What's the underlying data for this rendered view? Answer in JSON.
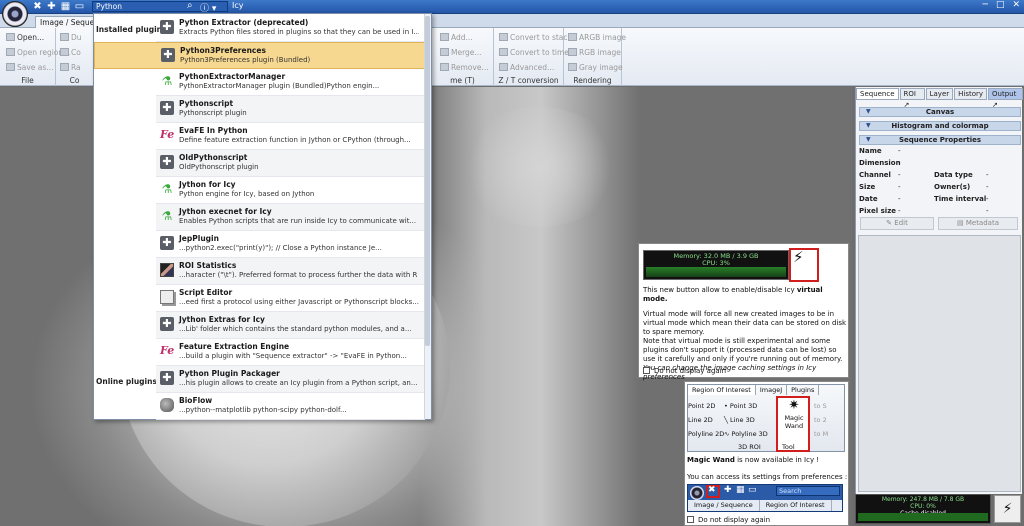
{
  "titlebar": {
    "search_value": "Python",
    "app_title": "Icy",
    "window_buttons": [
      "─",
      "□",
      "✕"
    ]
  },
  "ribbon": {
    "active_tab": "Image / Sequence",
    "file_group": {
      "title": "File",
      "items": [
        "Open...",
        "Open region...",
        "Save as..."
      ]
    },
    "co_group": {
      "title": "Co"
    },
    "middle_items": [
      "Add...",
      "Merge...",
      "Remove..."
    ],
    "middle_title": "me (T)",
    "zt_group": {
      "title": "Z / T conversion",
      "items": [
        "Convert to stack",
        "Convert to time",
        "Advanced..."
      ]
    },
    "render_group": {
      "title": "Rendering",
      "items": [
        "ARGB image",
        "RGB image",
        "Gray image"
      ]
    },
    "partial_left_items": [
      "Du",
      "Co",
      "Ra"
    ]
  },
  "dropdown": {
    "section_installed": "Installed plugins",
    "section_online": "Online plugins",
    "items": [
      {
        "name": "Python Extractor (deprecated)",
        "desc": "Extracts Python files stored in plugins so that they can be used in I...",
        "icon": "puzzle-icon"
      },
      {
        "name": "Python3Preferences",
        "desc": "Python3Preferences plugin (Bundled)",
        "icon": "puzzle-icon"
      },
      {
        "name": "PythonExtractorManager",
        "desc": "PythonExtractorManager plugin (Bundled)Python engin...",
        "icon": "flask-icon"
      },
      {
        "name": "Pythonscript",
        "desc": "Pythonscript plugin",
        "icon": "puzzle-icon"
      },
      {
        "name": "EvaFE In Python",
        "desc": "Define feature extraction function in Jython or CPython (through...",
        "icon": "fe-icon"
      },
      {
        "name": "OldPythonscript",
        "desc": "OldPythonscript plugin",
        "icon": "puzzle-icon"
      },
      {
        "name": "Jython for Icy",
        "desc": "Python engine for Icy, based on Jython",
        "icon": "flask-icon"
      },
      {
        "name": "Jython execnet for Icy",
        "desc": "Enables Python scripts that are run inside Icy to communicate wit...",
        "icon": "flask-icon"
      },
      {
        "name": "JepPlugin",
        "desc": "...python2.exec(\"print(y)\"); // Close a Python instance Je...",
        "icon": "puzzle-icon"
      },
      {
        "name": "ROI Statistics",
        "desc": "...haracter (\"\\t\"). Preferred format to process further the data with R or ...",
        "icon": "roi-icon"
      },
      {
        "name": "Script Editor",
        "desc": "...eed first a protocol using either Javascript or Pythonscript blocks...",
        "icon": "document-icon"
      },
      {
        "name": "Jython Extras for Icy",
        "desc": "...Lib' folder which contains the standard python modules, and a...",
        "icon": "puzzle-icon"
      },
      {
        "name": "Feature Extraction Engine",
        "desc": "...build a plugin with \"Sequence extractor\" -> \"EvaFE in Python...",
        "icon": "fe-icon"
      },
      {
        "name": "Python Plugin Packager",
        "desc": "...his plugin allows to create an Icy plugin from a Python script, an...",
        "icon": "puzzle-icon"
      },
      {
        "name": "BioFlow",
        "desc": "...python--matplotlib python-scipy python-dolf...",
        "icon": "rock-icon"
      }
    ]
  },
  "inspector": {
    "tabs": [
      "Sequence",
      "ROI",
      "Layer",
      "History",
      "Output"
    ],
    "bars": [
      "Canvas",
      "Histogram and colormap",
      "Sequence Properties"
    ],
    "props_left": [
      {
        "label": "Name",
        "value": "-"
      },
      {
        "label": "Dimension",
        "value": "-"
      },
      {
        "label": "Channel",
        "value": "-"
      },
      {
        "label": "Size",
        "value": "-"
      },
      {
        "label": "Date",
        "value": "-"
      },
      {
        "label": "Pixel size",
        "value": "-"
      }
    ],
    "props_right": [
      {
        "label": "Data type",
        "value": "-"
      },
      {
        "label": "Owner(s)",
        "value": "-"
      },
      {
        "label": "Time interval",
        "value": "-"
      },
      {
        "label": "",
        "value": "-"
      }
    ],
    "edit_label": "Edit",
    "metadata_label": "Metadata"
  },
  "popup1": {
    "memory_text": "Memory: 32.0 MB / 3.9 GB",
    "cpu_text": "CPU: 3%",
    "intro_pre": "This new button allow to enable/disable Icy ",
    "intro_bold": "virtual mode.",
    "body_1": "Virtual mode will force all new created images to be in virtual mode which mean their data can be stored on disk to spare memory.",
    "body_2": "Note that virtual mode is still experimental and some plugins don't support it (processed data can be lost) so use it carefully and only if you're running out of memory.",
    "body_3": "You can change the image caching settings in Icy preferences",
    "checkbox_label": "Do not display again"
  },
  "popup2": {
    "tabs": [
      "Region Of Interest",
      "ImageJ",
      "Plugins"
    ],
    "left_items": [
      "Point 2D",
      "Line 2D",
      "Polyline 2D"
    ],
    "mid_items": [
      "Point 3D",
      "Line 3D",
      "Polyline 3D"
    ],
    "group_3d": "3D ROI",
    "wand_label": "Magic Wand",
    "tool_label": "Tool",
    "right_items": [
      "to S",
      "to 2",
      "to M"
    ],
    "text_1_bold": "Magic Wand",
    "text_1_rest": " is now available in Icy !",
    "text_2": "You can access its settings from preferences :",
    "mini_search": "Search",
    "mini_tabs": [
      "Image / Sequence",
      "Region Of Interest"
    ],
    "checkbox_label": "Do not display again"
  },
  "memwidget": {
    "memory_text": "Memory: 247.8 MB / 7.8 GB",
    "cpu_text": "CPU: 0%",
    "cache_text": "Cache disabled"
  }
}
